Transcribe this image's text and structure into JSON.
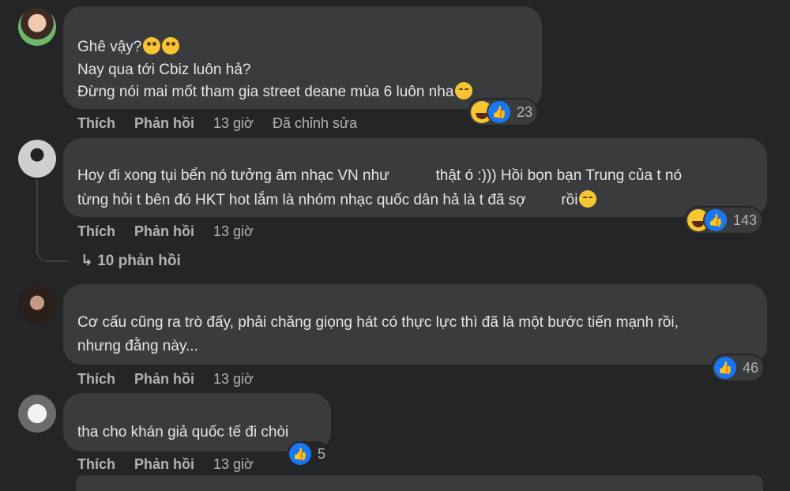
{
  "comments": [
    {
      "lines": [
        "Ghê vậy?",
        "Nay qua tới Cbiz luôn hả?",
        "Đừng nói mai mốt tham gia street deane mùa 6 luôn nha"
      ],
      "actions": {
        "like": "Thích",
        "reply": "Phản hồi",
        "time": "13 giờ",
        "edited": "Đã chỉnh sửa"
      },
      "reaction_count": "23"
    },
    {
      "lines": [
        "Hoy đi xong tụi bển nó tưởng âm nhạc VN như",
        "thật ó :))) Hồi bọn bạn Trung của t nó",
        "từng hỏi t bên đó HKT hot lắm là nhóm nhạc quốc dân hả là t đã sợ",
        "rồi"
      ],
      "actions": {
        "like": "Thích",
        "reply": "Phản hồi",
        "time": "13 giờ"
      },
      "reaction_count": "143",
      "replies_link": "10 phản hồi"
    },
    {
      "lines": [
        "Cơ cấu cũng ra trò đấy, phải chăng giọng hát có thực lực thì đã là một bước tiến mạnh rồi,",
        "nhưng đằng này..."
      ],
      "actions": {
        "like": "Thích",
        "reply": "Phản hồi",
        "time": "13 giờ"
      },
      "reaction_count": "46"
    },
    {
      "lines": [
        "tha cho khán giả quốc tế đi chòi"
      ],
      "actions": {
        "like": "Thích",
        "reply": "Phản hồi",
        "time": "13 giờ"
      },
      "reaction_count": "5"
    }
  ],
  "colors": {
    "background": "#242526",
    "bubble": "#3a3b3c",
    "text": "#e4e6eb",
    "muted": "#b0b3b8",
    "like_blue": "#1877f2",
    "haha_yellow": "#f7c531"
  }
}
